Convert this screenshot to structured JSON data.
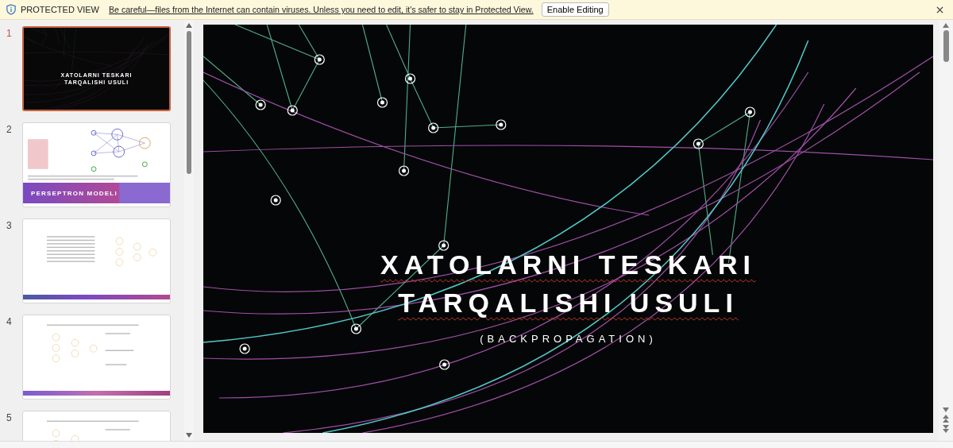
{
  "banner": {
    "label": "PROTECTED VIEW",
    "message": "Be careful—files from the Internet can contain viruses. Unless you need to edit, it's safer to stay in Protected View.",
    "button": "Enable Editing"
  },
  "slides": [
    {
      "number": "1",
      "selected": true,
      "kind": "title",
      "title_lines": [
        "XATOLARNI TESKARI",
        "TARQALISHI USULI"
      ]
    },
    {
      "number": "2",
      "selected": false,
      "kind": "perceptron",
      "caption": "PERSEPTRON MODELI"
    },
    {
      "number": "3",
      "selected": false,
      "kind": "network"
    },
    {
      "number": "4",
      "selected": false,
      "kind": "formulas"
    },
    {
      "number": "5",
      "selected": false,
      "kind": "partial"
    }
  ],
  "main_slide": {
    "title_lines": [
      "XATOLARNI TESKARI",
      "TARQALISHI USULI"
    ],
    "subtitle": "(BACKPROPAGATION)"
  }
}
